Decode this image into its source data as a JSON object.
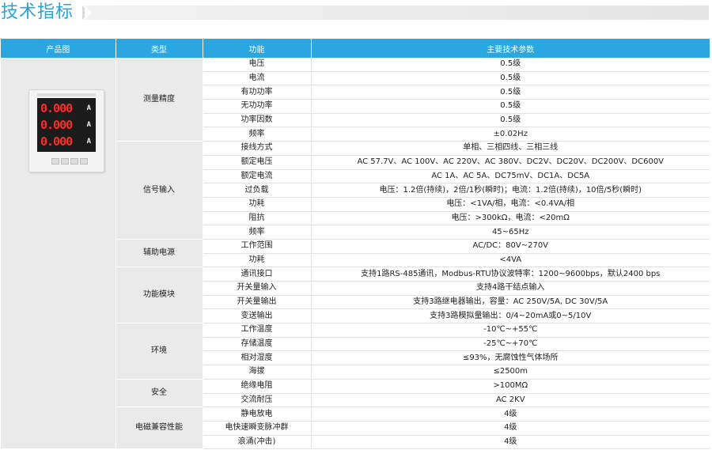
{
  "header": {
    "title": "技术指标"
  },
  "columns": {
    "image": "产品图",
    "type": "类型",
    "function": "功能",
    "params": "主要技术参数"
  },
  "meter": {
    "readings": [
      "0.000",
      "0.000",
      "0.000"
    ],
    "units": [
      "A",
      "A",
      "A"
    ]
  },
  "groups": [
    {
      "category": "测量精度",
      "rows": [
        {
          "fn": "电压",
          "val": "0.5级"
        },
        {
          "fn": "电流",
          "val": "0.5级"
        },
        {
          "fn": "有功功率",
          "val": "0.5级"
        },
        {
          "fn": "无功功率",
          "val": "0.5级"
        },
        {
          "fn": "功率因数",
          "val": "0.5级"
        },
        {
          "fn": "频率",
          "val": "±0.02Hz"
        }
      ]
    },
    {
      "category": "信号输入",
      "rows": [
        {
          "fn": "接线方式",
          "val": "单相、三相四线、三相三线"
        },
        {
          "fn": "额定电压",
          "val": "AC 57.7V、AC 100V、AC 220V、AC 380V、DC2V、DC20V、DC200V、DC600V"
        },
        {
          "fn": "额定电流",
          "val": "AC 1A、AC 5A、DC75mV、DC1A、DC5A"
        },
        {
          "fn": "过负载",
          "val": "电压：1.2倍(持续)，2倍/1秒(瞬时)；电流：1.2倍(持续)，10倍/5秒(瞬时)"
        },
        {
          "fn": "功耗",
          "val": "电压：<1VA/相，电流：<0.4VA/相"
        },
        {
          "fn": "阻抗",
          "val": "电压：>300kΩ，电流：<20mΩ"
        },
        {
          "fn": "频率",
          "val": "45~65Hz"
        }
      ]
    },
    {
      "category": "辅助电源",
      "rows": [
        {
          "fn": "工作范围",
          "val": "AC/DC：80V~270V"
        },
        {
          "fn": "功耗",
          "val": "<4VA"
        }
      ]
    },
    {
      "category": "功能模块",
      "rows": [
        {
          "fn": "通讯接口",
          "val": "支持1路RS-485通讯，Modbus-RTU协议波特率：1200~9600bps，默认2400 bps"
        },
        {
          "fn": "开关量输入",
          "val": "支持4路干结点输入"
        },
        {
          "fn": "开关量输出",
          "val": "支持3路继电器输出，容量：AC 250V/5A, DC 30V/5A"
        },
        {
          "fn": "变送输出",
          "val": "支持3路模拟量输出：0/4~20mA或0~5/10V"
        }
      ]
    },
    {
      "category": "环境",
      "rows": [
        {
          "fn": "工作温度",
          "val": "-10℃~+55℃"
        },
        {
          "fn": "存储温度",
          "val": "-25℃~+70℃"
        },
        {
          "fn": "相对湿度",
          "val": "≤93%，无腐蚀性气体场所"
        },
        {
          "fn": "海拔",
          "val": "≤2500m"
        }
      ]
    },
    {
      "category": "安全",
      "rows": [
        {
          "fn": "绝缘电阻",
          "val": ">100MΩ"
        },
        {
          "fn": "交流耐压",
          "val": "AC 2KV"
        }
      ]
    },
    {
      "category": "电磁兼容性能",
      "rows": [
        {
          "fn": "静电放电",
          "val": "4级"
        },
        {
          "fn": "电快速瞬变脉冲群",
          "val": "4级"
        },
        {
          "fn": "浪涌(冲击)",
          "val": "4级"
        }
      ]
    }
  ]
}
